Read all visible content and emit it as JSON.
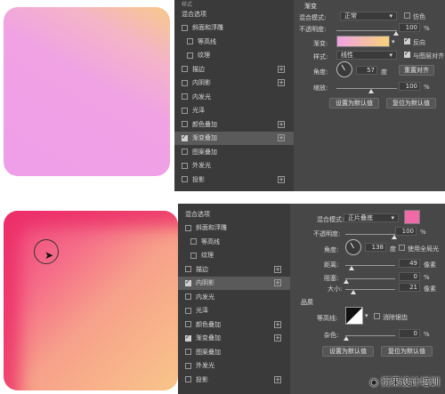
{
  "top": {
    "style_list": {
      "partial_header": "样式",
      "items": [
        {
          "label": "混合选项",
          "indent": false,
          "checked": null,
          "plus": false,
          "selected": false
        },
        {
          "label": "斜面和浮雕",
          "indent": false,
          "checked": false,
          "plus": false,
          "selected": false
        },
        {
          "label": "等高线",
          "indent": true,
          "checked": false,
          "plus": false,
          "selected": false
        },
        {
          "label": "纹理",
          "indent": true,
          "checked": false,
          "plus": false,
          "selected": false
        },
        {
          "label": "描边",
          "indent": false,
          "checked": false,
          "plus": true,
          "selected": false
        },
        {
          "label": "内阴影",
          "indent": false,
          "checked": false,
          "plus": true,
          "selected": false
        },
        {
          "label": "内发光",
          "indent": false,
          "checked": false,
          "plus": false,
          "selected": false
        },
        {
          "label": "光泽",
          "indent": false,
          "checked": false,
          "plus": false,
          "selected": false
        },
        {
          "label": "颜色叠加",
          "indent": false,
          "checked": false,
          "plus": true,
          "selected": false
        },
        {
          "label": "渐变叠加",
          "indent": false,
          "checked": true,
          "plus": true,
          "selected": true
        },
        {
          "label": "图案叠加",
          "indent": false,
          "checked": false,
          "plus": false,
          "selected": false
        },
        {
          "label": "外发光",
          "indent": false,
          "checked": false,
          "plus": false,
          "selected": false
        },
        {
          "label": "投影",
          "indent": false,
          "checked": false,
          "plus": true,
          "selected": false
        }
      ]
    },
    "settings": {
      "section_title": "渐变",
      "blend_mode_label": "混合模式:",
      "blend_mode_value": "正常",
      "dither_label": "仿色",
      "opacity_label": "不透明度:",
      "opacity_value": "100",
      "opacity_unit": "%",
      "gradient_label": "渐变:",
      "reverse_label": "反向",
      "style_label": "样式:",
      "style_value": "线性",
      "align_label": "与图层对齐",
      "angle_label": "角度:",
      "angle_value": "57",
      "angle_unit": "度",
      "reset_align_label": "重置对齐",
      "scale_label": "缩放:",
      "scale_value": "100",
      "scale_unit": "%",
      "set_default_label": "设置为默认值",
      "reset_default_label": "复位为默认值"
    }
  },
  "bottom": {
    "style_list": {
      "items": [
        {
          "label": "混合选项",
          "indent": false,
          "checked": null,
          "plus": false,
          "selected": false
        },
        {
          "label": "斜面和浮雕",
          "indent": false,
          "checked": false,
          "plus": false,
          "selected": false
        },
        {
          "label": "等高线",
          "indent": true,
          "checked": false,
          "plus": false,
          "selected": false
        },
        {
          "label": "纹理",
          "indent": true,
          "checked": false,
          "plus": false,
          "selected": false
        },
        {
          "label": "描边",
          "indent": false,
          "checked": false,
          "plus": true,
          "selected": false
        },
        {
          "label": "内阴影",
          "indent": false,
          "checked": true,
          "plus": true,
          "selected": true
        },
        {
          "label": "内发光",
          "indent": false,
          "checked": false,
          "plus": false,
          "selected": false
        },
        {
          "label": "光泽",
          "indent": false,
          "checked": false,
          "plus": false,
          "selected": false
        },
        {
          "label": "颜色叠加",
          "indent": false,
          "checked": false,
          "plus": true,
          "selected": false
        },
        {
          "label": "渐变叠加",
          "indent": false,
          "checked": true,
          "plus": true,
          "selected": false
        },
        {
          "label": "图案叠加",
          "indent": false,
          "checked": false,
          "plus": false,
          "selected": false
        },
        {
          "label": "外发光",
          "indent": false,
          "checked": false,
          "plus": false,
          "selected": false
        },
        {
          "label": "投影",
          "indent": false,
          "checked": false,
          "plus": true,
          "selected": false
        }
      ]
    },
    "settings": {
      "blend_mode_label": "混合模式:",
      "blend_mode_value": "正片叠底",
      "blend_color": "#f06aa8",
      "opacity_label": "不透明度:",
      "opacity_value": "100",
      "opacity_unit": "%",
      "angle_label": "角度:",
      "angle_value": "138",
      "angle_unit": "度",
      "global_light_label": "使用全局光",
      "distance_label": "距离:",
      "distance_value": "49",
      "distance_unit": "像素",
      "choke_label": "阻塞:",
      "choke_value": "0",
      "choke_unit": "%",
      "size_label": "大小:",
      "size_value": "21",
      "size_unit": "像素",
      "quality_title": "品质",
      "contour_label": "等高线:",
      "antialias_label": "消除锯齿",
      "noise_label": "杂色:",
      "noise_value": "0",
      "noise_unit": "%",
      "set_default_label": "设置为默认值",
      "reset_default_label": "复位为默认值"
    }
  },
  "watermark": {
    "text": "衍果设计培训"
  },
  "colors": {
    "panel_dark": "#3a3a3a",
    "panel_mid": "#474747",
    "gradient_start": "#f0a2e4",
    "gradient_end": "#f8c58a"
  },
  "icons": {
    "cursor": "arrow-cursor-icon",
    "plus": "plus-icon",
    "weibo": "weibo-icon"
  }
}
